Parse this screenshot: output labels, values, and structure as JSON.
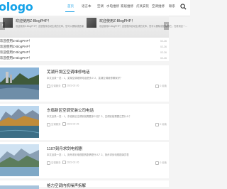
{
  "header": {
    "logo": "ologo",
    "nav": [
      "首页",
      "语言本",
      "空调",
      "水电维修",
      "家居维修",
      "灯具安装",
      "空调维修",
      "联系"
    ],
    "active_index": 0,
    "accent": "#1aa0e6"
  },
  "slider": [
    {
      "title": "欢迎使用Z-BlogPHP！",
      "desc": "欢迎使用Z-BlogPHP！这是程序自动生成的文章，您可以删除或是编辑它。在看到这一..."
    },
    {
      "title": "欢迎使用Z-BlogPHP！",
      "desc": "欢迎使用Z-BlogPHP！这是程序自动生成的文章，您可以删除或是编辑它。在看到这一..."
    }
  ],
  "list": [
    {
      "text": "欢迎使用Z-BlogPHP！",
      "date": "02-26"
    },
    {
      "text": "欢迎使用Z-BlogPHP！",
      "date": "02-26"
    },
    {
      "text": "欢迎使用Z-BlogPHP！",
      "date": "02-26"
    },
    {
      "text": "欢迎使用Z-BlogPHP！",
      "date": "02-26"
    }
  ],
  "articles": [
    {
      "title": "芜湖开发区空调维修电话",
      "excerpt": "本文目录一览：1、芜湖空调维修电话是多少 2、芜湖空调维修哪家好？",
      "author": "空调服务",
      "date": "2023-02-26",
      "views": "0 阅读"
    },
    {
      "title": "东临新区空调安装公司电话",
      "excerpt": "本文目录一览：1、东临新区空调安装需要多少钱？2、空调安装需要注意什么？",
      "author": "空调服务",
      "date": "2023-02-26",
      "views": "0 阅读"
    },
    {
      "title": "1107刻舟求剑电视剧",
      "excerpt": "本文目录一览：1、刻舟求剑电视剧的剧情是什么？2、刻舟求剑电视剧演员表",
      "author": "空调服务",
      "date": "2023-02-26",
      "views": "0 阅读"
    },
    {
      "title": "格力空调内机噪声拆解",
      "excerpt": "",
      "author": "",
      "date": "",
      "views": ""
    }
  ]
}
